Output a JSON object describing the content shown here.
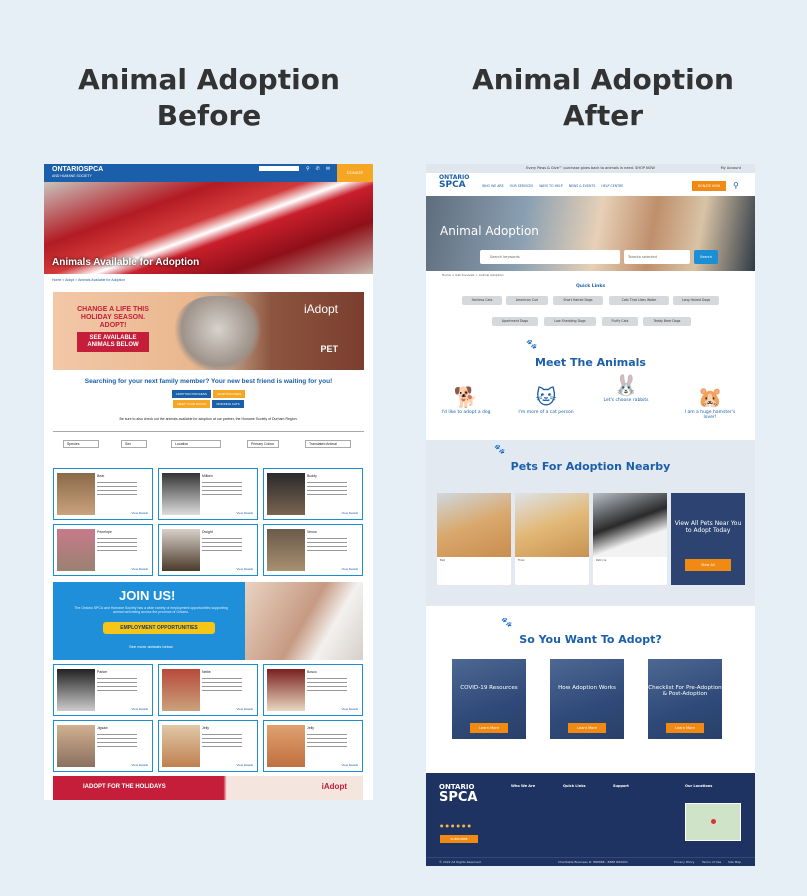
{
  "headings": {
    "before": "Animal Adoption Before",
    "after": "Animal Adoption After"
  },
  "before": {
    "logo": "ONTARIOSPCA",
    "logo_sub": "AND HUMANE SOCIETY",
    "donate": "DONATE",
    "hero_title": "Animals Available for Adoption",
    "breadcrumb": "Home > Adopt > Animals Available for Adoption",
    "banner": {
      "line1": "CHANGE A LIFE THIS HOLIDAY SEASON. ADOPT!",
      "cta": "SEE AVAILABLE ANIMALS BELOW",
      "brand": "iAdopt",
      "presented": "Presented by",
      "sponsor": "PET"
    },
    "search_text": "Searching for your next family member? Your new best friend is waiting for you!",
    "buttons": [
      "ADOPTION PROCESS",
      "ADOPTION FEES",
      "MEET YOUR MATCH",
      "WORKING CATS"
    ],
    "note": "Be sure to also check out the animals available for adoption at our partner, the Humane Society of Durham Region.",
    "filters": [
      "Species",
      "Sex",
      "Location",
      "Primary Colour",
      "Translated Animal"
    ],
    "cards": [
      {
        "name": "Bear"
      },
      {
        "name": "Miliken"
      },
      {
        "name": "Buddy"
      },
      {
        "name": "Penelope"
      },
      {
        "name": "Dwight"
      },
      {
        "name": "Venus"
      }
    ],
    "cards2": [
      {
        "name": "Parker"
      },
      {
        "name": "Nellie"
      },
      {
        "name": "Bosco"
      },
      {
        "name": "Jigsaw"
      },
      {
        "name": "Jelly"
      },
      {
        "name": "Jelly"
      }
    ],
    "view_details": "View Details",
    "join": {
      "title": "JOIN US!",
      "text": "The Ontario SPCA and Humane Society has a wide variety of employment opportunities supporting animal well-being across the province of Ontario.",
      "button": "EMPLOYMENT OPPORTUNITIES",
      "more": "See more animals below"
    },
    "holiday": "IADOPT FOR THE HOLIDAYS",
    "holiday_brand": "iAdopt"
  },
  "after": {
    "topbar": "Every Paws & Give™ purchase gives back to animals in need. SHOP NOW",
    "account": "My Account",
    "logo_top": "ONTARIO",
    "logo_main": "SPCA",
    "menu": [
      "WHO WE ARE",
      "OUR SERVICES",
      "WAYS TO HELP",
      "NEWS & EVENTS",
      "HELP CENTRE"
    ],
    "donate": "DONATE NOW",
    "hero_title": "Animal Adoption",
    "search_placeholder": "Search keywords",
    "location": "Toronto selected",
    "search_btn": "Search",
    "breadcrumb": "Home > Get Involved > Animal Adoption",
    "quick_links_title": "Quick Links",
    "quick_links": [
      "Hairless Cats",
      "American Curl",
      "Short Haired Dogs",
      "Cats That Likes Water",
      "Long Haired Dogs",
      "Apartment Dogs",
      "Low Shedding Dogs",
      "Fluffy Cats",
      "Teddy Bear Dogs"
    ],
    "meet_title": "Meet The Animals",
    "meet": [
      {
        "label": "I'd like to adopt a dog"
      },
      {
        "label": "I'm more of a cat person"
      },
      {
        "label": "Let's choose rabbits"
      },
      {
        "label": "I am a huge hamster's lover!"
      }
    ],
    "nearby_title": "Pets For Adoption Nearby",
    "pets": [
      {
        "name": "Bell"
      },
      {
        "name": "Fidel"
      },
      {
        "name": "Patricia"
      }
    ],
    "view_all": "View All Pets Near You to Adopt Today",
    "view_all_btn": "View All",
    "want_title": "So You Want To Adopt?",
    "adopt": [
      {
        "label": "COVID-19 Resources"
      },
      {
        "label": "How Adoption Works"
      },
      {
        "label": "Checklist For Pre-Adoption & Post-Adoption"
      }
    ],
    "learn_more": "Learn More",
    "footer": {
      "who": "Who We Are",
      "quick": "Quick Links",
      "support": "Support",
      "loc": "Our Locations",
      "copyright": "© 2022 All Rights Reserved",
      "charity": "Charitable Business #: 888888 - 8888 RR0001",
      "links": [
        "Privacy Policy",
        "Terms of Use",
        "Site Map"
      ],
      "subscribe": "SUBSCRIBE"
    }
  }
}
